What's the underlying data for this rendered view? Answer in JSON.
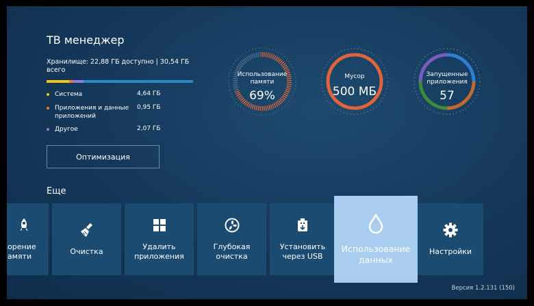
{
  "app": {
    "title": "ТВ менеджер"
  },
  "storage": {
    "summary": "Хранилище: 22,88 ГБ доступно | 30,54 ГБ всего",
    "bar": {
      "track_color": "#2a8bc4",
      "segments": [
        {
          "name": "Система",
          "fraction": 0.152,
          "color": "#f0c419"
        },
        {
          "name": "Приложения и данные приложений",
          "fraction": 0.031,
          "color": "#e8803a"
        },
        {
          "name": "Другое",
          "fraction": 0.068,
          "color": "#8e7be8"
        }
      ]
    },
    "items": [
      {
        "label": "Система",
        "value": "4,64 ГБ",
        "color": "#f0c419"
      },
      {
        "label": "Приложения и данные приложений",
        "value": "0,95 ГБ",
        "color": "#e8803a"
      },
      {
        "label": "Другое",
        "value": "2,07 ГБ",
        "color": "#8e7be8"
      }
    ],
    "optimize_label": "Оптимизация"
  },
  "gauges": [
    {
      "label": "Использование памяти",
      "value": "69%",
      "fill": 0.69,
      "color": "#e0643a",
      "style": "ticks"
    },
    {
      "label": "Мусор",
      "value": "500 МБ",
      "color": "#e0643a",
      "style": "ring"
    },
    {
      "label": "Запущенные приложения",
      "value": "57",
      "style": "multi",
      "segments": [
        {
          "color": "#2e7fd0",
          "fraction": 0.25
        },
        {
          "color": "#c26a2e",
          "fraction": 0.25
        },
        {
          "color": "#3d8a3b",
          "fraction": 0.25
        },
        {
          "color": "#7a5bbf",
          "fraction": 0.25
        }
      ]
    }
  ],
  "more": {
    "title": "Еще",
    "tiles": [
      {
        "label": "корение\nамяти",
        "icon": "rocket-icon"
      },
      {
        "label": "Очистка",
        "icon": "broom-icon"
      },
      {
        "label": "Удалить\nприложения",
        "icon": "grid-icon"
      },
      {
        "label": "Глубокая\nочистка",
        "icon": "fan-icon"
      },
      {
        "label": "Установить\nчерез USB",
        "icon": "usb-icon"
      },
      {
        "label": "Использование\nданных",
        "icon": "drop-icon",
        "selected": true
      },
      {
        "label": "Настройки",
        "icon": "gear-icon"
      }
    ]
  },
  "version": "Версия 1.2.131 (150)"
}
